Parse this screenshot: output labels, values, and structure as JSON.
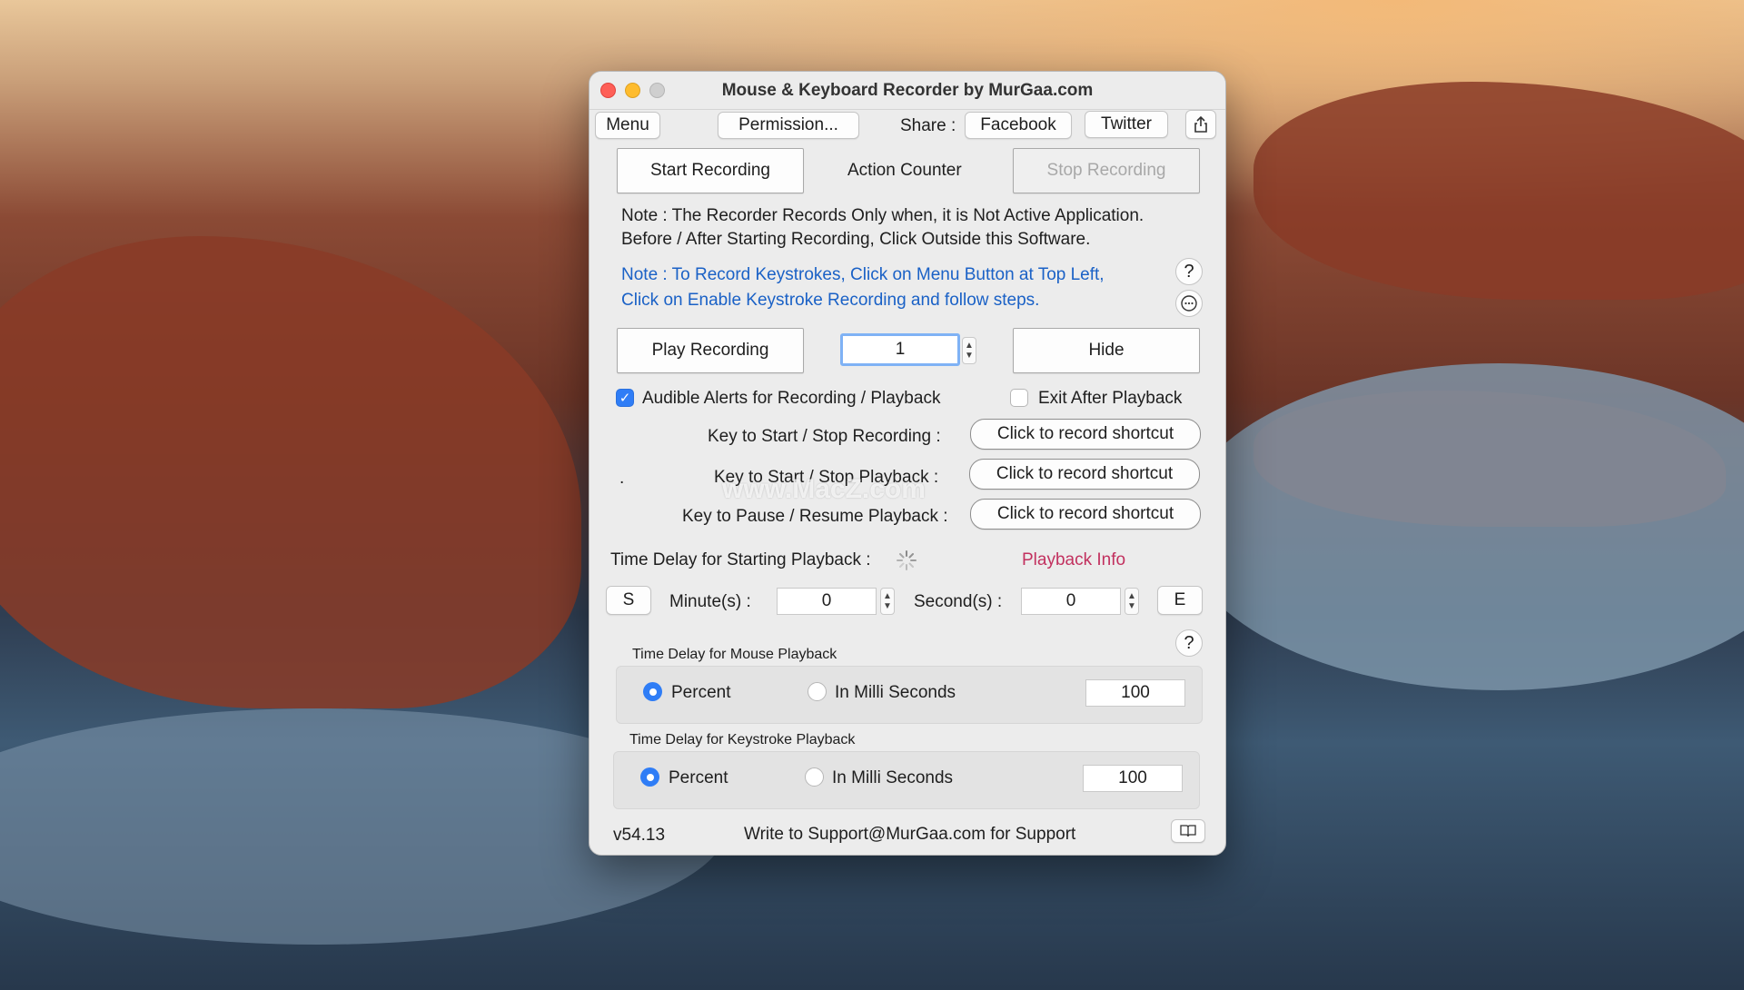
{
  "window": {
    "title": "Mouse & Keyboard Recorder by MurGaa.com"
  },
  "toolbar": {
    "menu_label": "Menu",
    "permission_label": "Permission...",
    "share_label": "Share :",
    "facebook_label": "Facebook",
    "twitter_label": "Twitter",
    "share_icon": "share-icon"
  },
  "recording": {
    "start_label": "Start Recording",
    "action_counter_label": "Action Counter",
    "stop_label": "Stop Recording"
  },
  "notes": {
    "note1_line1": "Note : The Recorder Records Only when, it is Not Active Application.",
    "note1_line2": "Before / After Starting Recording, Click Outside this Software.",
    "note2_line1": "Note : To Record Keystrokes, Click on Menu Button at Top Left,",
    "note2_line2": "Click on Enable Keystroke Recording and follow steps.",
    "help_label": "?"
  },
  "playback": {
    "play_label": "Play Recording",
    "count_value": "1",
    "hide_label": "Hide"
  },
  "options": {
    "audible_alerts_label": "Audible Alerts for Recording / Playback",
    "audible_alerts_checked": true,
    "exit_after_label": "Exit After Playback",
    "exit_after_checked": false
  },
  "shortcuts": {
    "dot": ".",
    "start_stop_recording_label": "Key to Start / Stop Recording :",
    "start_stop_playback_label": "Key to Start / Stop Playback  :",
    "pause_resume_label": "Key to Pause / Resume Playback :",
    "record_shortcut_label": "Click to record shortcut"
  },
  "delay": {
    "starting_label": "Time Delay for Starting Playback :",
    "playback_info_label": "Playback Info",
    "s_label": "S",
    "minutes_label": "Minute(s) :",
    "minutes_value": "0",
    "seconds_label": "Second(s) :",
    "seconds_value": "0",
    "e_label": "E",
    "help_label": "?"
  },
  "mouse_delay": {
    "title": "Time Delay for Mouse Playback",
    "percent_label": "Percent",
    "ms_label": "In Milli Seconds",
    "value": "100",
    "selected": "percent"
  },
  "keystroke_delay": {
    "title": "Time Delay for Keystroke Playback",
    "percent_label": "Percent",
    "ms_label": "In Milli Seconds",
    "value": "100",
    "selected": "percent"
  },
  "footer": {
    "version": "v54.13",
    "support_text": "Write to Support@MurGaa.com for Support",
    "book_icon": "book-icon"
  },
  "watermark": "www.MacZ.com",
  "colors": {
    "accent": "#2f7df6",
    "note_blue": "#1a61c6",
    "playback_info": "#c2315f"
  }
}
